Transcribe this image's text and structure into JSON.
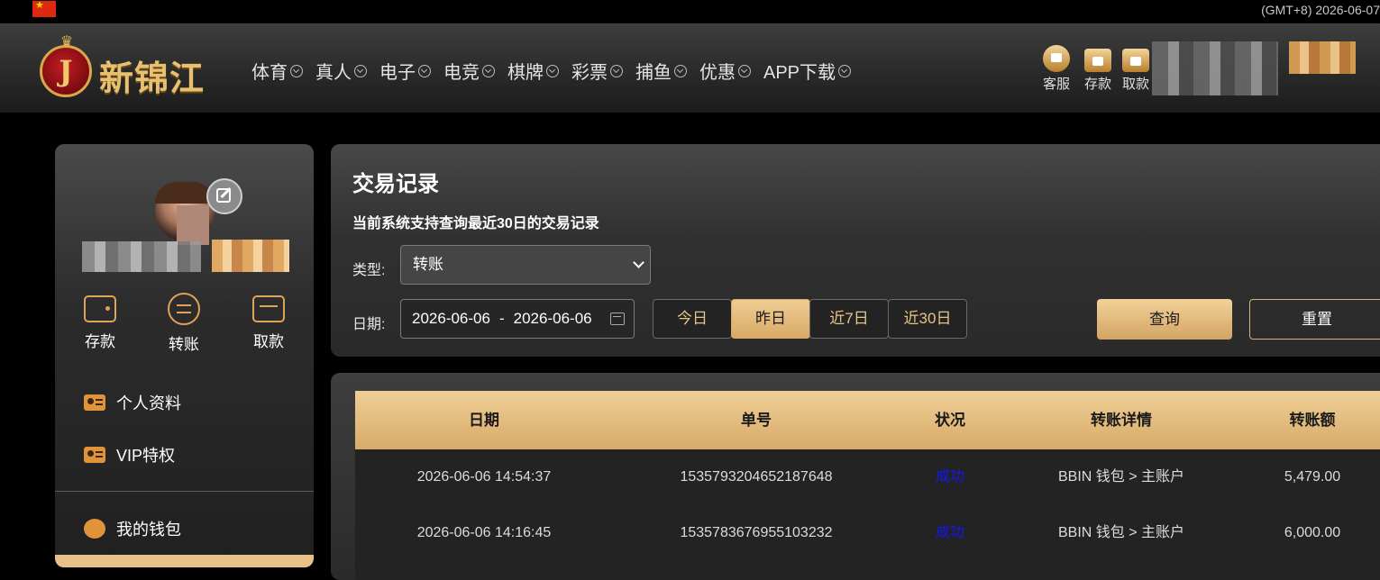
{
  "topbar": {
    "datetime": "(GMT+8) 2026-06-07"
  },
  "brand": {
    "logo_text": "新锦江",
    "logo_letter": "J"
  },
  "nav": {
    "items": [
      {
        "label": "体育"
      },
      {
        "label": "真人"
      },
      {
        "label": "电子"
      },
      {
        "label": "电竞"
      },
      {
        "label": "棋牌"
      },
      {
        "label": "彩票"
      },
      {
        "label": "捕鱼"
      },
      {
        "label": "优惠"
      },
      {
        "label": "APP下载"
      }
    ]
  },
  "quick_actions": {
    "service": "客服",
    "deposit": "存款",
    "withdraw": "取款"
  },
  "sidebar": {
    "wallet_buttons": {
      "deposit": "存款",
      "transfer": "转账",
      "withdraw": "取款"
    },
    "menu": {
      "profile": "个人资料",
      "vip": "VIP特权",
      "wallet": "我的钱包"
    }
  },
  "filter": {
    "title": "交易记录",
    "subtitle": "当前系统支持查询最近30日的交易记录",
    "type_label": "类型:",
    "type_value": "转账",
    "date_label": "日期:",
    "date_from": "2026-06-06",
    "date_sep": "-",
    "date_to": "2026-06-06",
    "quick_dates": [
      {
        "label": "今日"
      },
      {
        "label": "昨日",
        "active": true
      },
      {
        "label": "近7日"
      },
      {
        "label": "近30日"
      }
    ],
    "query_label": "查询",
    "reset_label": "重置"
  },
  "table": {
    "columns": [
      "日期",
      "单号",
      "状况",
      "转账详情",
      "转账额"
    ],
    "rows": [
      {
        "date": "2026-06-06 14:54:37",
        "order": "1535793204652187648",
        "status": "成功",
        "detail": "BBIN 钱包 > 主账户",
        "amount": "5,479.00"
      },
      {
        "date": "2026-06-06 14:16:45",
        "order": "1535783676955103232",
        "status": "成功",
        "detail": "BBIN 钱包 > 主账户",
        "amount": "6,000.00"
      }
    ]
  },
  "colors": {
    "gold": "#e0a35a",
    "accent_gradient_top": "#f0cf97",
    "status_success": "#1414ff"
  }
}
